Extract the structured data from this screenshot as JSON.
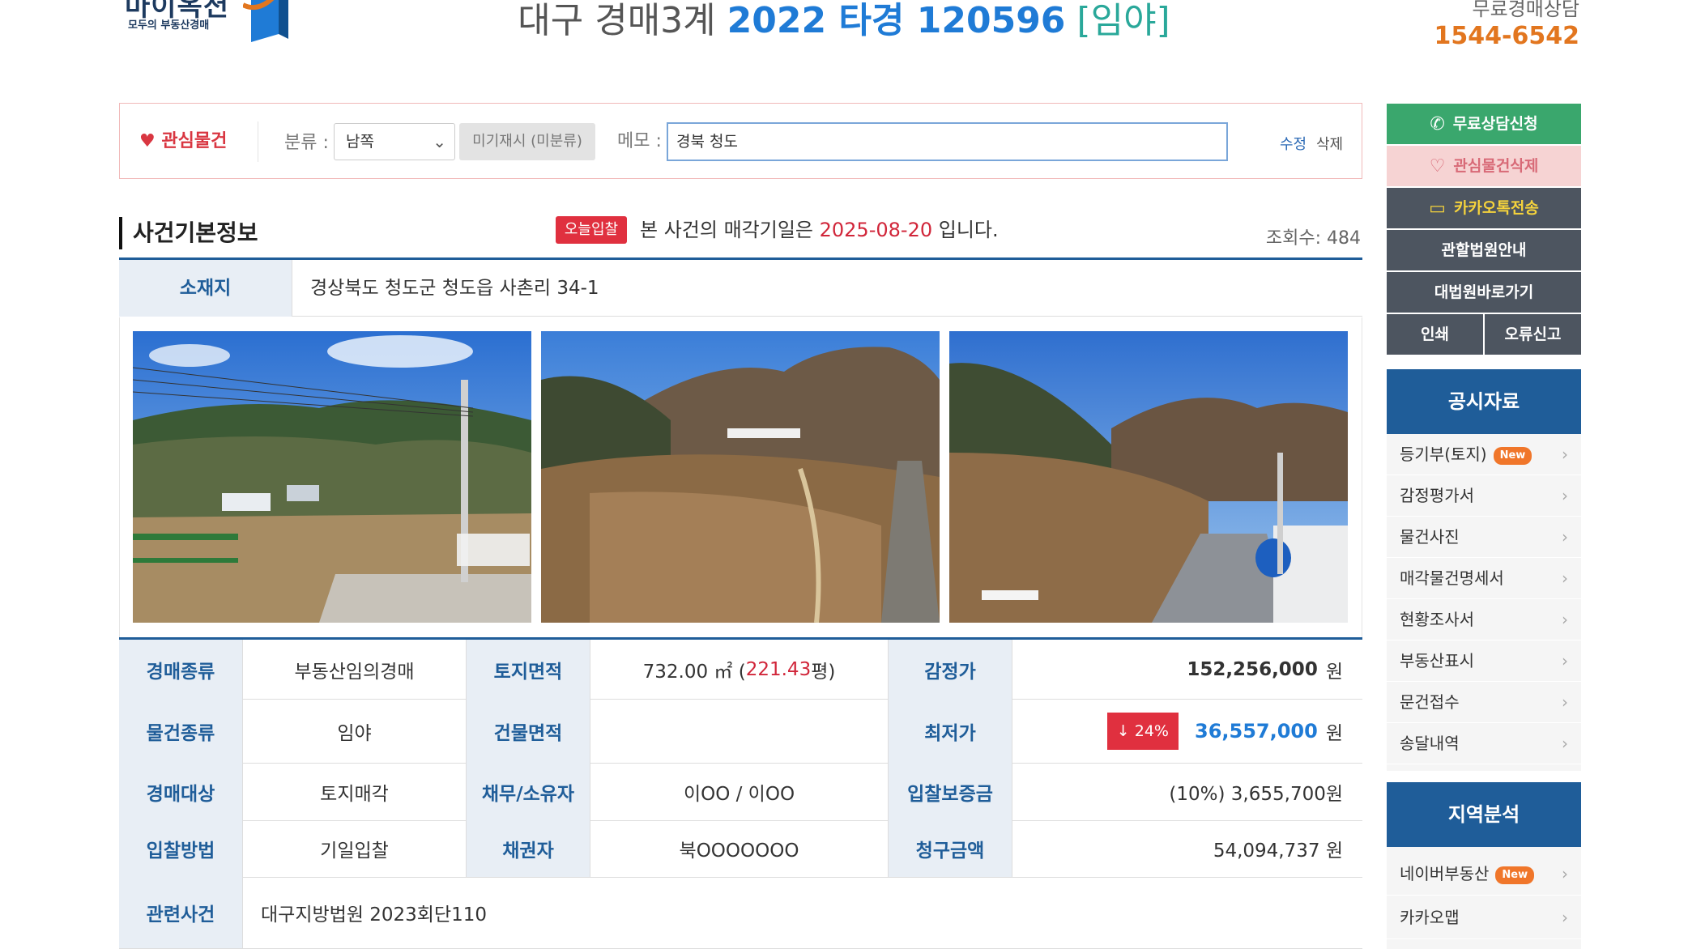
{
  "header": {
    "logo_text": "마이옥션",
    "logo_sub": "모두의 부동산경매",
    "title_court": "대구 경매3계",
    "title_case": "2022 타경 120596",
    "title_type": "[임야]",
    "consult_label": "무료경매상담",
    "consult_phone": "1544-6542"
  },
  "filter": {
    "favorite_label": "관심물건",
    "category_label": "분류 :",
    "category_value": "남쪽",
    "unassigned_label": "미기재시 (미분류)",
    "memo_label": "메모 :",
    "memo_value": "경북 청도",
    "edit_label": "수정",
    "delete_label": "삭제"
  },
  "section": {
    "title": "사건기본정보",
    "today_badge": "오늘입찰",
    "sale_prefix": "본 사건의 매각기일은",
    "sale_date": "2025-08-20",
    "sale_suffix": "입니다.",
    "views": "조회수: 484"
  },
  "address": {
    "label": "소재지",
    "value": "경상북도 청도군 청도읍 사촌리 34-1"
  },
  "info": {
    "auction_type_label": "경매종류",
    "auction_type": "부동산임의경매",
    "land_area_label": "토지면적",
    "land_area_m2": "732.00 ㎡ (",
    "land_area_pyeong": "221.43",
    "land_area_suffix": "평)",
    "appraisal_label": "감정가",
    "appraisal": "152,256,000",
    "won": "원",
    "property_type_label": "물건종류",
    "property_type": "임야",
    "building_area_label": "건물면적",
    "building_area": "",
    "min_price_label": "최저가",
    "drop_badge": "↓ 24%",
    "min_price": "36,557,000",
    "target_label": "경매대상",
    "target": "토지매각",
    "debtor_label": "채무/소유자",
    "debtor": "이OO / 이OO",
    "deposit_label": "입찰보증금",
    "deposit": "(10%) 3,655,700원",
    "bid_method_label": "입찰방법",
    "bid_method": "기일입찰",
    "creditor_label": "채권자",
    "creditor": "북OOOOOOO",
    "claim_label": "청구금액",
    "claim": "54,094,737 원",
    "related_label": "관련사건",
    "related": "대구지방법원 2023회단110"
  },
  "sidebar": {
    "consult_btn": "무료상담신청",
    "fav_delete_btn": "관심물건삭제",
    "kakao_btn": "카카오톡전송",
    "court_btn": "관할법원안내",
    "supreme_btn": "대법원바로가기",
    "print_btn": "인쇄",
    "report_btn": "오류신고",
    "public_docs_title": "공시자료",
    "public_docs": [
      "등기부(토지)",
      "감정평가서",
      "물건사진",
      "매각물건명세서",
      "현황조사서",
      "부동산표시",
      "문건접수",
      "송달내역"
    ],
    "new_badge": "New",
    "region_title": "지역분석",
    "region_items": [
      "네이버부동산",
      "카카오맵"
    ]
  },
  "colors": {
    "accent_blue": "#1f5d99",
    "link_blue": "#1f7bd6",
    "red": "#d1263a",
    "green": "#3aa76d",
    "orange": "#e2761f"
  }
}
